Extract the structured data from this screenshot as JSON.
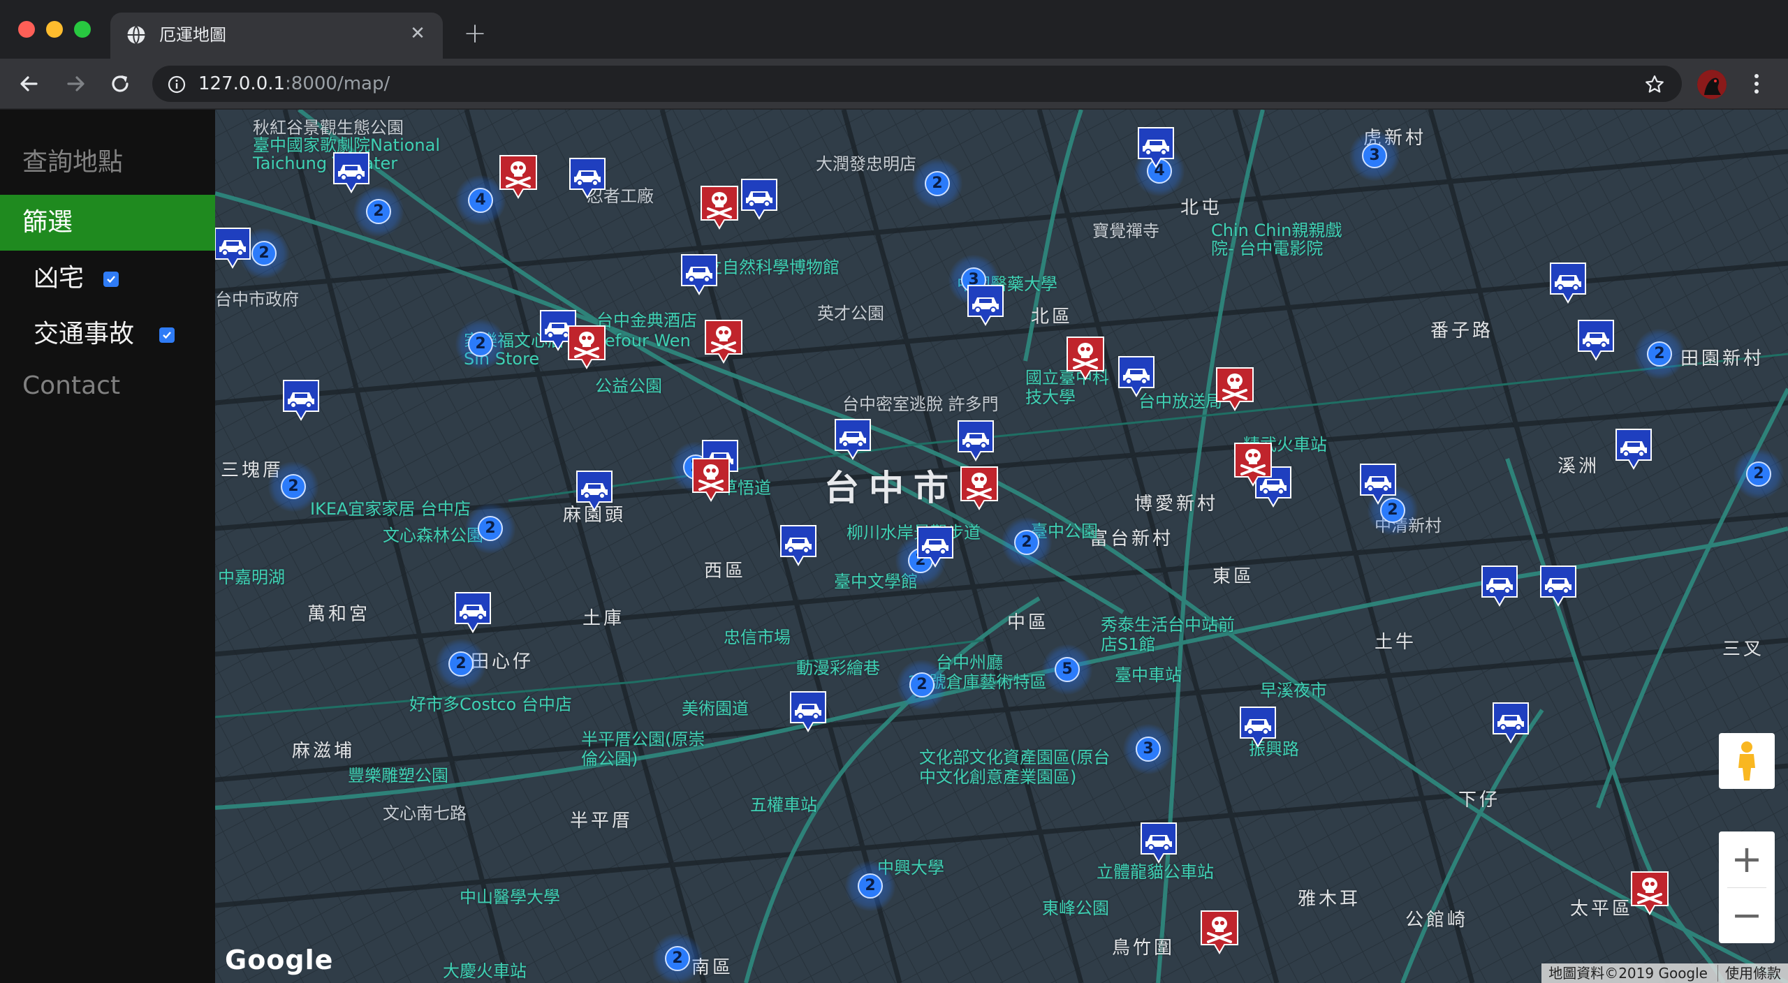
{
  "browser": {
    "tab_title": "厄運地圖",
    "url_host": "127.0.0.1",
    "url_rest": ":8000/map/"
  },
  "sidebar": {
    "title": "查詢地點",
    "active_item": "篩選",
    "filters": [
      {
        "label": "凶宅",
        "checked": true
      },
      {
        "label": "交通事故",
        "checked": true
      }
    ],
    "contact": "Contact"
  },
  "map": {
    "city_label": "台中市",
    "districts": [
      "北屯",
      "北區",
      "西區",
      "中區",
      "東區",
      "南區",
      "土庫",
      "麻園頭",
      "田心仔",
      "半平厝",
      "麻滋埔",
      "三塊厝",
      "土牛",
      "下仔",
      "雅木耳",
      "公館崎",
      "太平區",
      "溪洲",
      "三叉",
      "番子路",
      "博愛新村",
      "富台新村",
      "鳥竹圍",
      "萬和宮",
      "田園新村",
      "虎新村"
    ],
    "places": [
      "秋紅谷景觀生態公園",
      "臺中國家歌劇院National Taichung Theater",
      "忍者工廠",
      "大潤發忠明店",
      "國立自然科學博物館",
      "寶覺禪寺",
      "Chin Chin親親戲院- 台中電影院",
      "中國醫藥大學",
      "台中金典酒店",
      "家樂福文心店 Carrefour Wen Sin Store",
      "英才公園",
      "公益公園",
      "台中密室逃脫 許多門",
      "國立臺中科技大學",
      "台中放送局",
      "精武火車站",
      "中清新村",
      "柳川水岸景觀步道",
      "臺中公園",
      "臺中文學館",
      "IKEA宜家家居 台中店",
      "文心森林公園",
      "草悟道",
      "忠信市場",
      "動漫彩繪巷",
      "台中州廳",
      "20號倉庫藝術特區",
      "秀泰生活台中站前店S1館",
      "臺中車站",
      "早溪夜市",
      "美術園道",
      "好市多Costco 台中店",
      "半平厝公園(原崇倫公園)",
      "豐樂雕塑公園",
      "文化部文化資產園區(原台中文化創意產業園區)",
      "五權車站",
      "振興路",
      "中興大學",
      "立體龍貓公車站",
      "東峰公園",
      "中山醫學大學",
      "大慶火車站",
      "中嘉明湖",
      "文心南七路",
      "台中市政府"
    ],
    "clusters": [
      "2",
      "4",
      "2",
      "2",
      "3",
      "4",
      "3",
      "2",
      "2",
      "2",
      "2",
      "2",
      "2",
      "2",
      "2",
      "5",
      "2",
      "3",
      "2",
      "2",
      "2",
      "2"
    ],
    "attribution": "地圖資料©2019 Google",
    "terms": "使用條款",
    "logo": "Google"
  }
}
